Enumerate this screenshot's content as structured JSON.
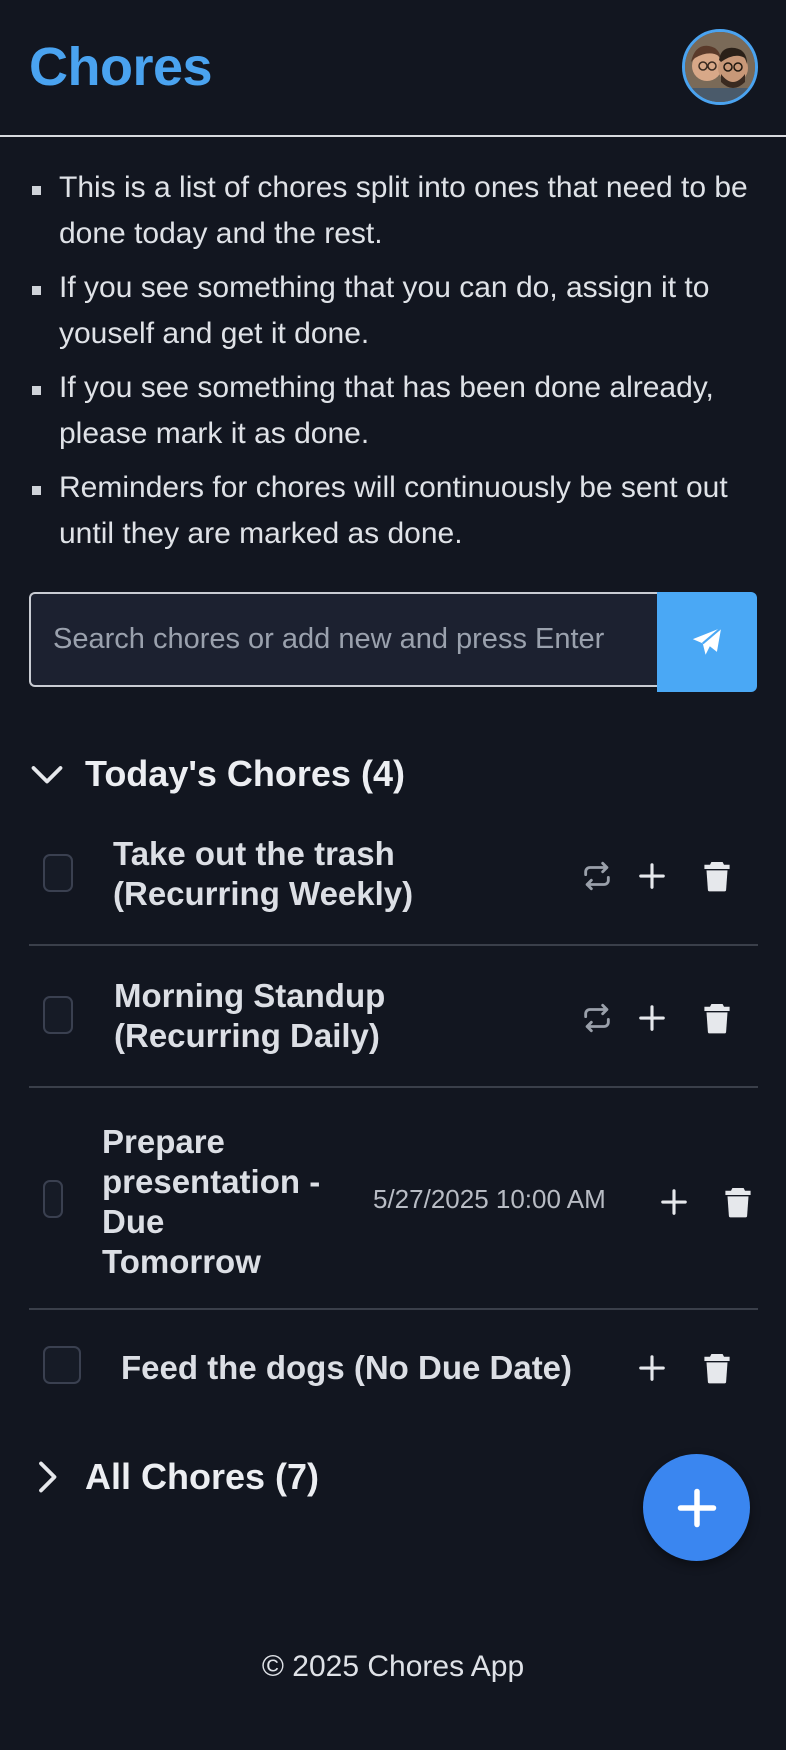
{
  "header": {
    "title": "Chores"
  },
  "info": [
    "This is a list of chores split into ones that need to be done today and the rest.",
    "If you see something that you can do, assign it to youself and get it done.",
    "If you see something that has been done already, please mark it as done.",
    "Reminders for chores will continuously be sent out until they are marked as done."
  ],
  "search": {
    "placeholder": "Search chores or add new and press Enter",
    "value": ""
  },
  "today": {
    "title": "Today's Chores (4)",
    "expanded": true,
    "chores": [
      {
        "title": "Take out the trash (Recurring Weekly)",
        "recurring": true,
        "due": ""
      },
      {
        "title": "Morning Standup (Recurring Daily)",
        "recurring": true,
        "due": ""
      },
      {
        "title": "Prepare presentation - Due Tomorrow",
        "recurring": false,
        "due": "5/27/2025 10:00 AM"
      },
      {
        "title": "Feed the dogs (No Due Date)",
        "recurring": false,
        "due": ""
      }
    ]
  },
  "all": {
    "title": "All Chores (7)",
    "expanded": false
  },
  "footer": {
    "text": "© 2025 Chores App"
  },
  "colors": {
    "background": "#121620",
    "accent": "#4aa3f0",
    "fab": "#3a86f0"
  }
}
